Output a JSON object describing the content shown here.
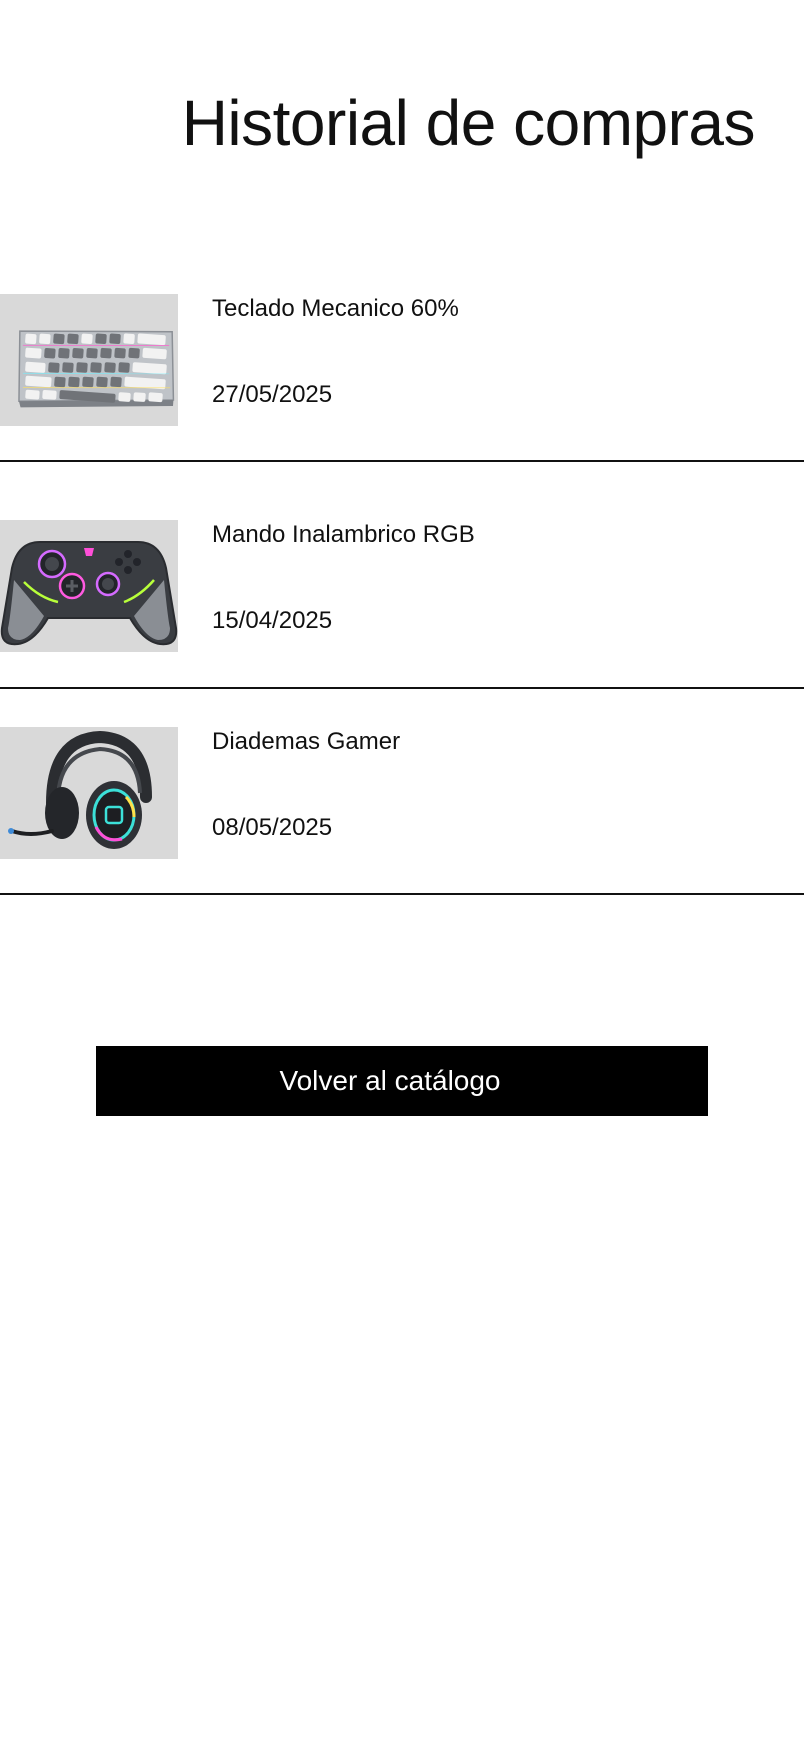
{
  "page": {
    "title": "Historial de compras"
  },
  "purchases": [
    {
      "name": "Teclado Mecanico 60%",
      "date": "27/05/2025",
      "icon": "keyboard-image"
    },
    {
      "name": "Mando Inalambrico RGB",
      "date": "15/04/2025",
      "icon": "gamepad-image"
    },
    {
      "name": "Diademas Gamer",
      "date": "08/05/2025",
      "icon": "headset-image"
    }
  ],
  "actions": {
    "back_label": "Volver al catálogo"
  },
  "colors": {
    "background": "#ffffff",
    "thumb_bg": "#d9d9d9",
    "button_bg": "#000000",
    "button_text": "#ffffff",
    "divider": "#111111"
  }
}
